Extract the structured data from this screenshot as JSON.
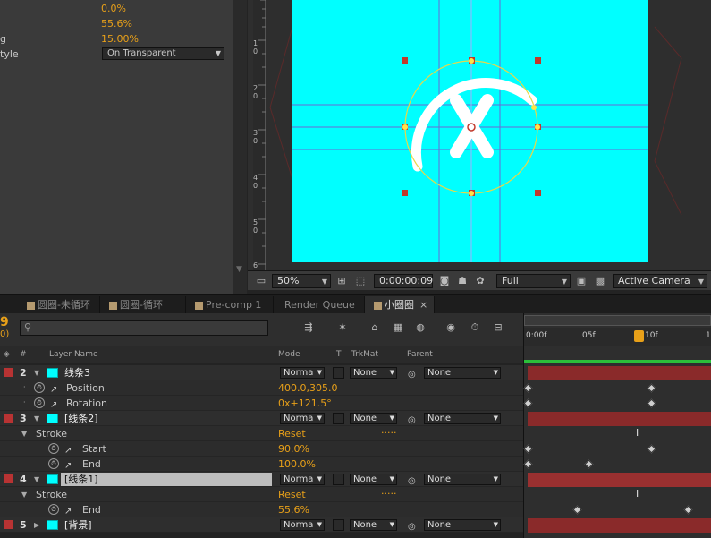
{
  "effects": {
    "rows": [
      {
        "label": "",
        "value": "0.0%"
      },
      {
        "label": "",
        "value": "55.6%"
      },
      {
        "label": "g",
        "value": "15.00%"
      }
    ],
    "style_label": "tyle",
    "style_select": "On Transparent"
  },
  "viewer": {
    "zoom": "50%",
    "timecode": "0:00:00:09",
    "resolution": "Full",
    "view": "Active Camera",
    "ruler_ticks": [
      "1",
      "0",
      "2",
      "0",
      "3",
      "0",
      "4",
      "0",
      "5",
      "0",
      "6"
    ]
  },
  "tabs": [
    {
      "label": "圆圈-未循环",
      "active": false
    },
    {
      "label": "圆圈-循环",
      "active": false
    },
    {
      "label": "Pre-comp 1",
      "active": false
    },
    {
      "label": "Render Queue",
      "active": false
    },
    {
      "label": "小圈圈",
      "active": true
    }
  ],
  "timeline": {
    "timecode_fragment": "9",
    "timecode_sub": "0)",
    "search_placeholder": "",
    "header": {
      "num": "#",
      "layer_name": "Layer Name",
      "mode": "Mode",
      "t": "T",
      "trkmat": "TrkMat",
      "parent": "Parent"
    },
    "ruler": {
      "t0": "0:00f",
      "t1": "05f",
      "t2": "10f",
      "t3": "1"
    },
    "layers": [
      {
        "num": "2",
        "name": "线条3",
        "mode": "Norma",
        "trkmat": "None",
        "parent": "None",
        "color": "#b83333"
      },
      {
        "prop": "Position",
        "value": "400.0,305.0"
      },
      {
        "prop": "Rotation",
        "value": "0x+121.5°"
      },
      {
        "num": "3",
        "name": "[线条2]",
        "mode": "Norma",
        "trkmat": "None",
        "parent": "None",
        "color": "#b83333"
      },
      {
        "group": "Stroke",
        "value": "Reset",
        "dots": "....."
      },
      {
        "prop": "Start",
        "value": "90.0%"
      },
      {
        "prop": "End",
        "value": "100.0%"
      },
      {
        "num": "4",
        "name": "[线条1]",
        "mode": "Norma",
        "trkmat": "None",
        "parent": "None",
        "color": "#b83333",
        "selected": true
      },
      {
        "group": "Stroke",
        "value": "Reset",
        "dots": "....."
      },
      {
        "prop": "End",
        "value": "55.6%"
      },
      {
        "num": "5",
        "name": "[背景]",
        "mode": "Norma",
        "trkmat": "None",
        "parent": "None",
        "color": "#b83333"
      }
    ]
  },
  "colors": {
    "accent": "#e8a019",
    "canvas": "#00ffff",
    "layer_bar": "#8a2a2a",
    "playhead": "#e02020"
  }
}
